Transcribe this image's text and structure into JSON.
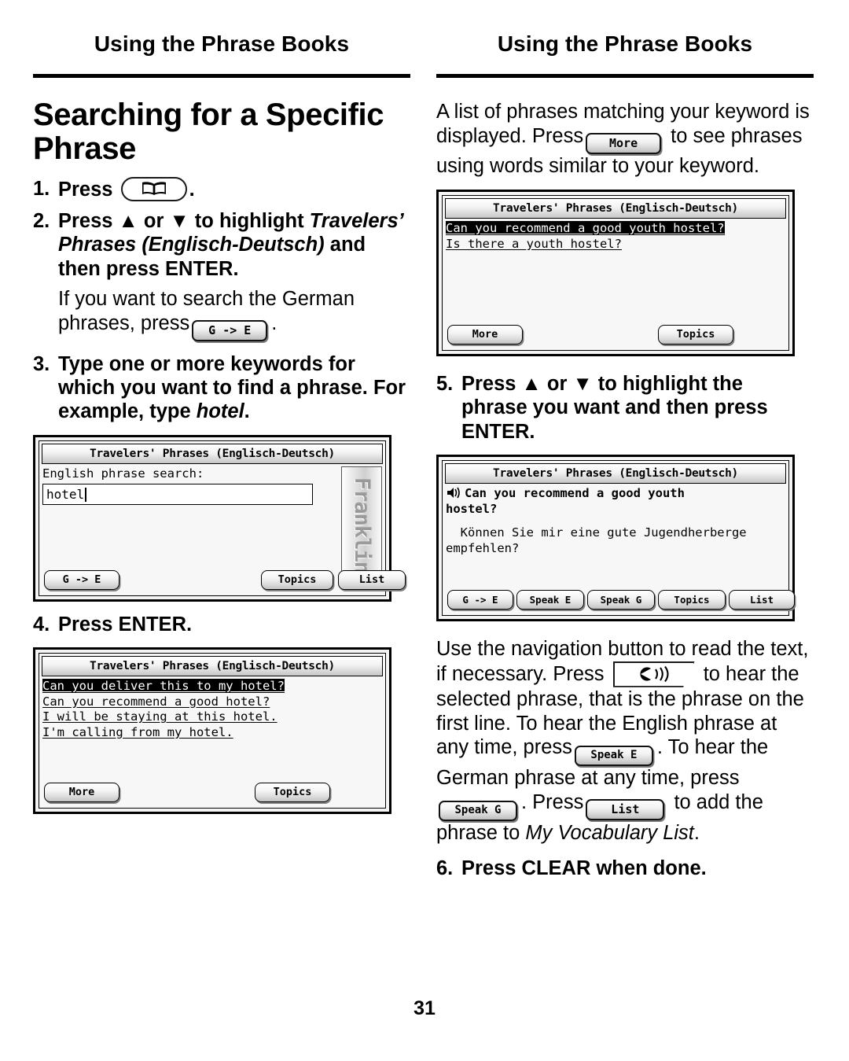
{
  "running_head": "Using the Phrase Books",
  "page_number": "31",
  "left": {
    "title": "Searching for a Specific Phrase",
    "steps": {
      "s1_num": "1.",
      "s1_text_before": "Press",
      "s1_text_after": ".",
      "s1_key_icon": "book-key-icon",
      "s2_num": "2.",
      "s2_line1": "Press ▲ or ▼ to highlight",
      "s2_italic": "Travelers’ Phrases (Englisch-Deutsch)",
      "s2_line3": " and then press ENTER.",
      "s2_note_a": "If you want to search the German phrases, press",
      "s2_note_btn": "G -> E",
      "s2_note_b": ".",
      "s3_num": "3.",
      "s3_text": "Type one or more keywords for which you want to find a phrase. For example, type ",
      "s3_italic": "hotel",
      "s3_tail": ".",
      "s4_num": "4.",
      "s4_text": "Press ENTER."
    }
  },
  "right": {
    "intro_a": "A list of phrases matching your keyword is displayed. Press",
    "intro_btn": "More",
    "intro_b": " to see phrases using words similar to your keyword.",
    "s5_num": "5.",
    "s5_text": "Press ▲ or ▼ to highlight the phrase you want and then press ENTER.",
    "nav_a": "Use the navigation button to read the text, if necessary. Press",
    "nav_key_icon": "speak-key-icon",
    "nav_b": " to hear the selected phrase, that is the phrase on the first line. To hear the English phrase at any time, press",
    "nav_btn_speak_e": "Speak E",
    "nav_c": ". To hear the German phrase at any time, press",
    "nav_btn_speak_g": "Speak G",
    "nav_d": ". Press",
    "nav_btn_list": "List",
    "nav_e": " to add the phrase to ",
    "nav_italic": "My Vocabulary List",
    "nav_f": ".",
    "s6_num": "6.",
    "s6_text": "Press CLEAR when done."
  },
  "screens": {
    "search": {
      "title": "Travelers' Phrases (Englisch-Deutsch)",
      "label": "English phrase search:",
      "input_value": "hotel",
      "watermark": "Franklin",
      "buttons": {
        "left": "G -> E",
        "mid": "Topics",
        "right": "List"
      }
    },
    "results_hotel": {
      "title": "Travelers' Phrases (Englisch-Deutsch)",
      "phrases": [
        "Can you deliver this to my hotel?",
        "Can you recommend a good hotel?",
        "I will be staying at this hotel.",
        "I'm calling from my hotel."
      ],
      "selected_index": 0,
      "buttons": {
        "left": "More",
        "right": "Topics"
      }
    },
    "results_hostel": {
      "title": "Travelers' Phrases (Englisch-Deutsch)",
      "phrases": [
        "Can you recommend a good youth hostel?",
        "Is there a youth hostel?"
      ],
      "selected_index": 0,
      "buttons": {
        "left": "More",
        "right": "Topics"
      }
    },
    "detail": {
      "title": "Travelers' Phrases (Englisch-Deutsch)",
      "english": "Can you recommend a good youth\nhostel?",
      "german": "  Können Sie mir eine gute Jugendherberge\nempfehlen?",
      "buttons": [
        "G -> E",
        "Speak E",
        "Speak G",
        "Topics",
        "List"
      ]
    }
  }
}
